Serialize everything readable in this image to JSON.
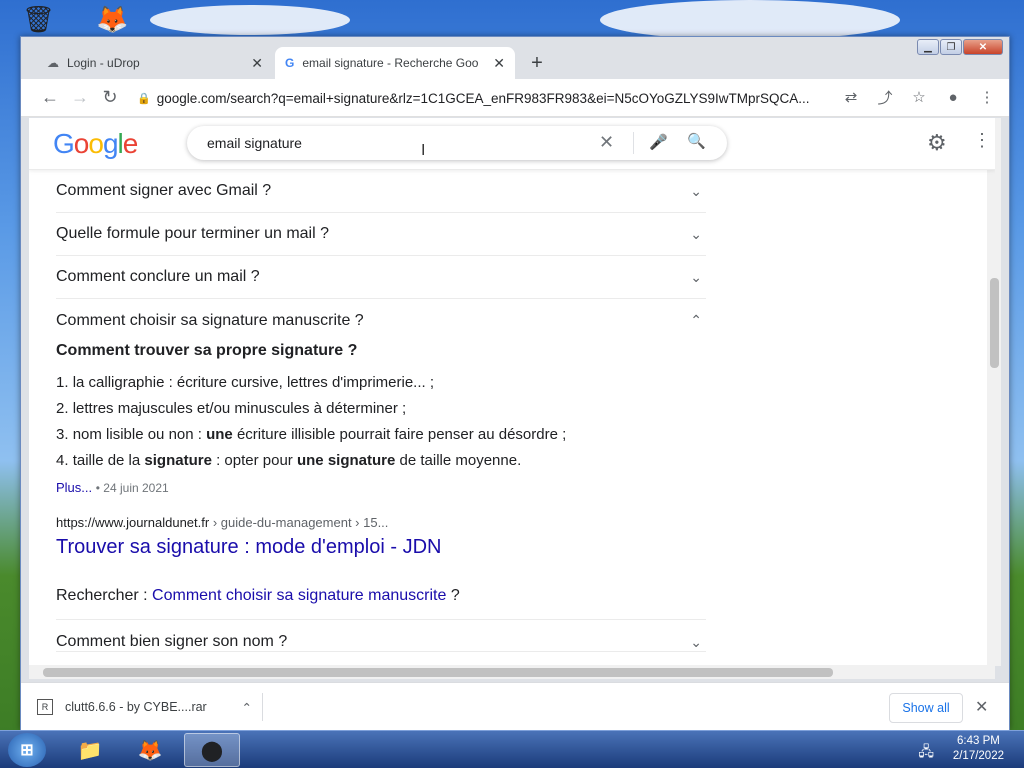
{
  "browser": {
    "tabs": [
      {
        "label": "Login - uDrop",
        "icon": "cloud-icon"
      },
      {
        "label": "email signature - Recherche Goo",
        "icon": "google-icon"
      }
    ],
    "url": "google.com/search?q=email+signature&rlz=1C1GCEA_enFR983FR983&ei=N5cOYoGZLYS9IwTMprSQCA..."
  },
  "google": {
    "logo": [
      "G",
      "o",
      "o",
      "g",
      "l",
      "e"
    ],
    "query": "email signature"
  },
  "paa": [
    {
      "question": "Comment signer avec Gmail ?"
    },
    {
      "question": "Quelle formule pour terminer un mail ?"
    },
    {
      "question": "Comment conclure un mail ?"
    },
    {
      "question": "Comment choisir sa signature manuscrite ?"
    }
  ],
  "answer": {
    "title": "Comment trouver sa propre signature ?",
    "items": [
      {
        "a": "la calligraphie : écriture cursive, lettres d'imprimerie... ;",
        "b": "",
        "c": ""
      },
      {
        "a": "lettres majuscules et/ou minuscules à déterminer ;",
        "b": "",
        "c": ""
      },
      {
        "a": "nom lisible ou non : ",
        "b": "une",
        "c": " écriture illisible pourrait faire penser au désordre ;"
      },
      {
        "a": "taille de la ",
        "b": "signature",
        "c": " : opter pour ",
        "d": "une signature",
        "e": " de taille moyenne."
      }
    ],
    "more": "Plus...",
    "date": "24 juin 2021",
    "site": "https://www.journaldunet.fr",
    "path": " › guide-du-management › 15...",
    "result_title": "Trouver sa signature : mode d'emploi - JDN",
    "search_prefix": "Rechercher : ",
    "search_link": "Comment choisir sa signature manuscrite",
    "search_suffix": " ?"
  },
  "next_question": "Comment bien signer son nom ?",
  "download": {
    "file": "clutt6.6.6 - by CYBE....rar",
    "show_all": "Show all"
  },
  "clock": {
    "time": "6:43 PM",
    "date": "2/17/2022"
  }
}
